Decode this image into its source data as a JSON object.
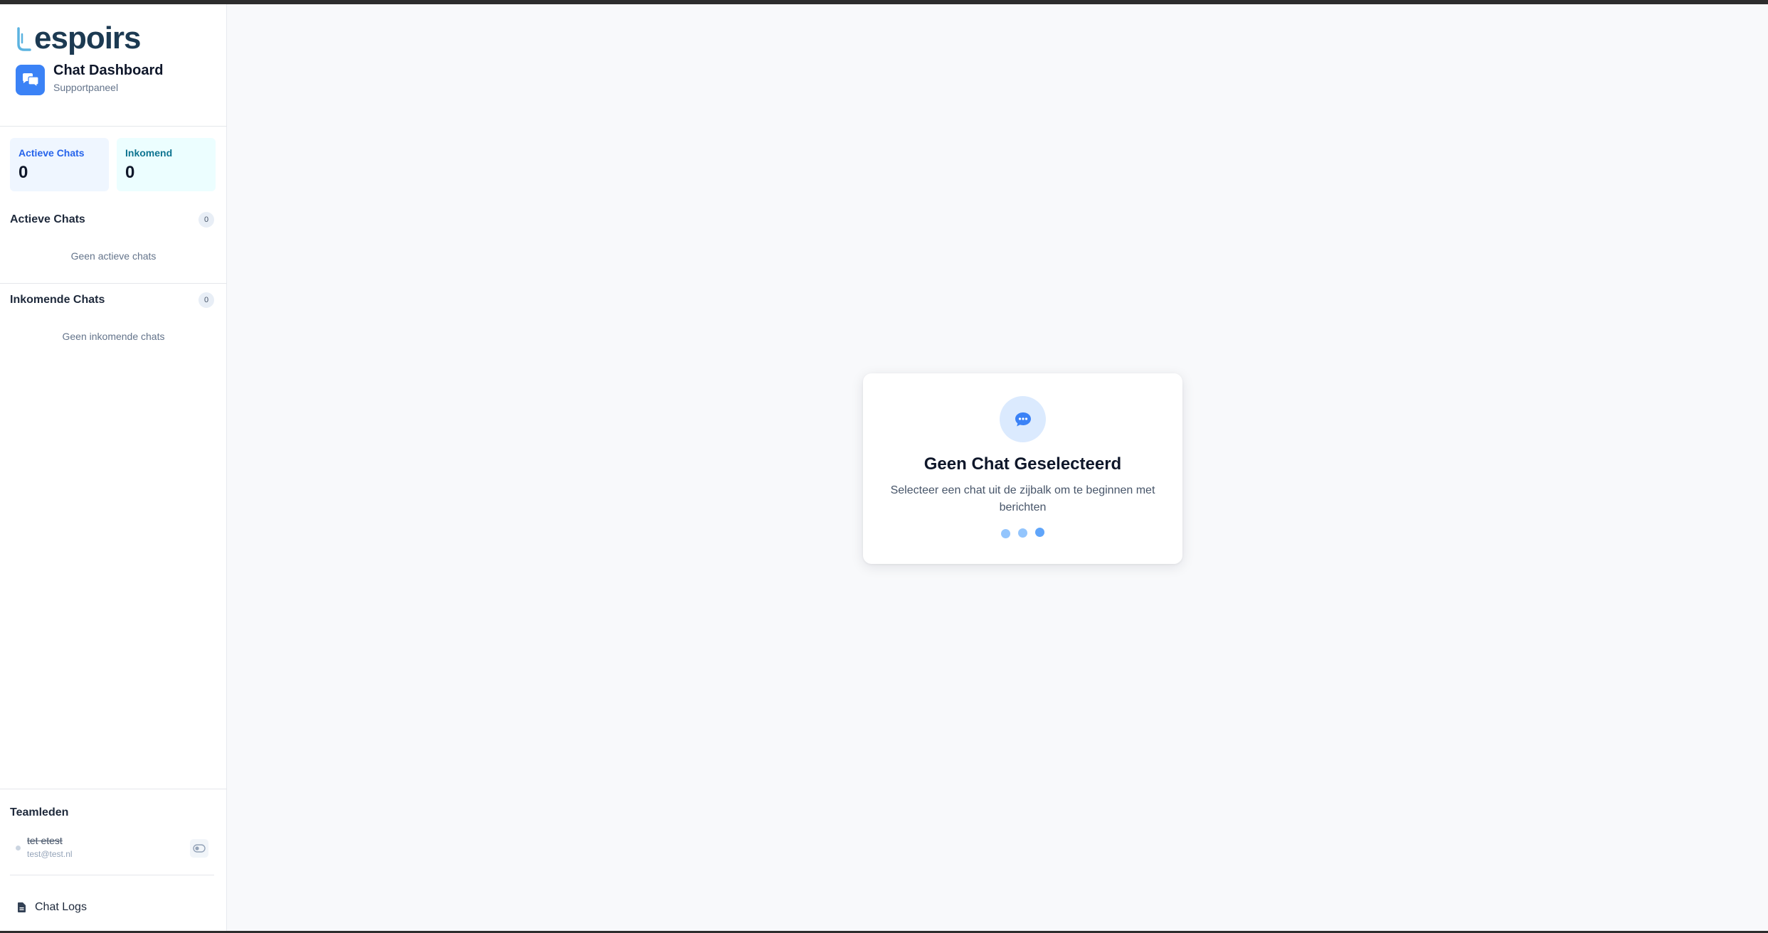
{
  "brand": {
    "logo_text": "espoirs"
  },
  "header": {
    "title": "Chat Dashboard",
    "subtitle": "Supportpaneel"
  },
  "stats": [
    {
      "label": "Actieve Chats",
      "value": "0"
    },
    {
      "label": "Inkomend",
      "value": "0"
    }
  ],
  "sections": {
    "active": {
      "title": "Actieve Chats",
      "count": "0",
      "empty": "Geen actieve chats"
    },
    "incoming": {
      "title": "Inkomende Chats",
      "count": "0",
      "empty": "Geen inkomende chats"
    }
  },
  "team": {
    "title": "Teamleden",
    "members": [
      {
        "name": "tet etest",
        "email": "test@test.nl",
        "status": "offline"
      }
    ]
  },
  "footer": {
    "logs_label": "Chat Logs"
  },
  "empty_state": {
    "title": "Geen Chat Geselecteerd",
    "text": "Selecteer een chat uit de zijbalk om te beginnen met berichten"
  },
  "colors": {
    "accent": "#3b82f6",
    "brand_dark": "#1c3a52",
    "brand_light": "#5bb3e0"
  },
  "icons": {
    "app": "chat-bubbles-icon",
    "empty_state": "chat-dots-icon",
    "toggle": "toggle-off-icon",
    "logs": "document-icon"
  }
}
